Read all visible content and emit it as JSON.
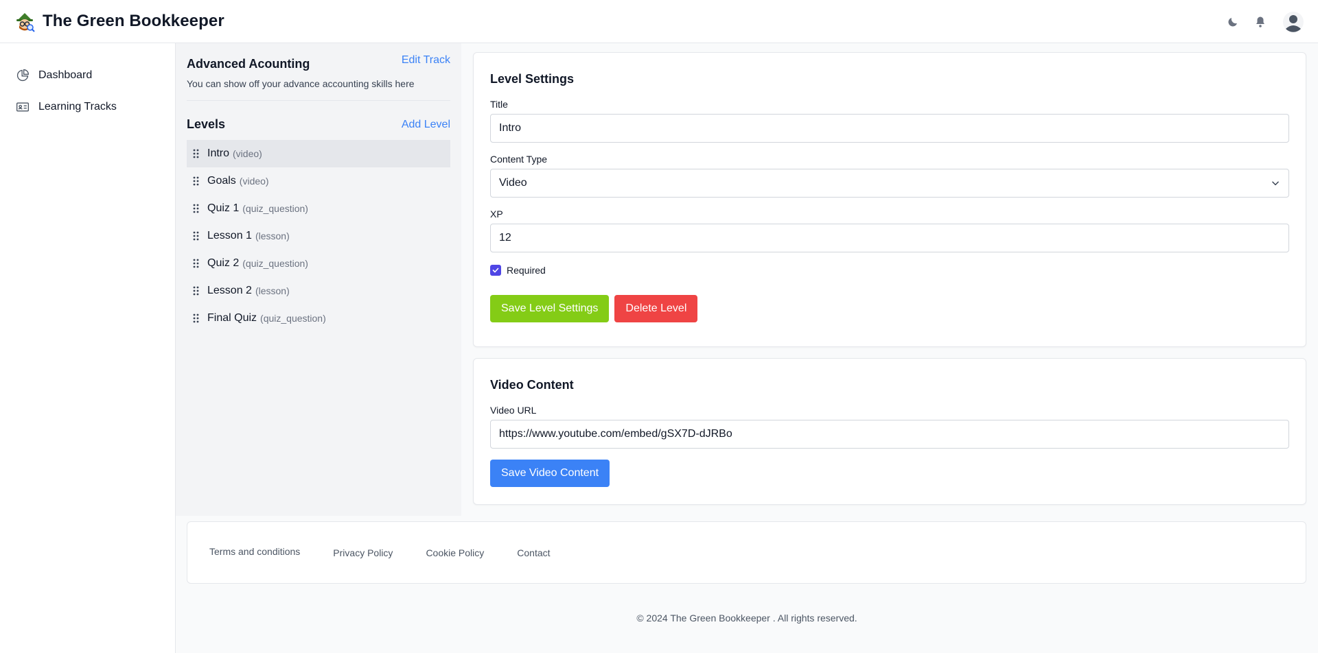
{
  "header": {
    "brand": "The Green Bookkeeper",
    "icons": [
      "logo-icon",
      "moon-icon",
      "bell-icon",
      "user-avatar-icon"
    ]
  },
  "sidebar": {
    "items": [
      {
        "label": "Dashboard",
        "icon": "pie-chart-icon"
      },
      {
        "label": "Learning Tracks",
        "icon": "id-card-icon"
      }
    ]
  },
  "track": {
    "title": "Advanced Acounting",
    "edit_label": "Edit Track",
    "description": "You can show off your advance accounting skills here",
    "levels_title": "Levels",
    "add_level_label": "Add Level",
    "levels": [
      {
        "name": "Intro",
        "type": "(video)",
        "active": true
      },
      {
        "name": "Goals",
        "type": "(video)"
      },
      {
        "name": "Quiz 1",
        "type": "(quiz_question)"
      },
      {
        "name": "Lesson 1",
        "type": "(lesson)"
      },
      {
        "name": "Quiz 2",
        "type": "(quiz_question)"
      },
      {
        "name": "Lesson 2",
        "type": "(lesson)"
      },
      {
        "name": "Final Quiz",
        "type": "(quiz_question)"
      }
    ]
  },
  "level_settings": {
    "title": "Level Settings",
    "title_label": "Title",
    "title_value": "Intro",
    "content_type_label": "Content Type",
    "content_type_value": "Video",
    "xp_label": "XP",
    "xp_value": "12",
    "required_label": "Required",
    "required_checked": true,
    "save_label": "Save Level Settings",
    "delete_label": "Delete Level"
  },
  "video_content": {
    "title": "Video Content",
    "url_label": "Video URL",
    "url_value": "https://www.youtube.com/embed/gSX7D-dJRBo",
    "save_label": "Save Video Content"
  },
  "footer": {
    "links": [
      "Terms and conditions",
      "Privacy Policy",
      "Cookie Policy",
      "Contact"
    ],
    "copyright": "© 2024 The Green Bookkeeper . All rights reserved."
  },
  "colors": {
    "accent_blue": "#3b82f6",
    "save_green": "#84cc16",
    "delete_red": "#ef4444",
    "checkbox": "#4f46e5"
  }
}
